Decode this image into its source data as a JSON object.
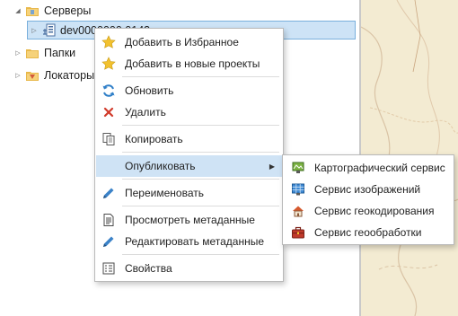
{
  "tree": {
    "servers_label": "Серверы",
    "server_item_label": "dev0000000.0143",
    "folders_label": "Папки",
    "locators_label": "Локаторы"
  },
  "context_menu": {
    "items": [
      {
        "label": "Добавить в Избранное",
        "icon": "star-icon"
      },
      {
        "label": "Добавить в новые проекты",
        "icon": "star-icon"
      },
      {
        "label": "Обновить",
        "icon": "refresh-icon"
      },
      {
        "label": "Удалить",
        "icon": "delete-icon"
      },
      {
        "label": "Копировать",
        "icon": "copy-icon"
      },
      {
        "label": "Опубликовать",
        "icon": "",
        "has_submenu": true,
        "highlighted": true
      },
      {
        "label": "Переименовать",
        "icon": "pencil-icon"
      },
      {
        "label": "Просмотреть метаданные",
        "icon": "metadata-icon"
      },
      {
        "label": "Редактировать метаданные",
        "icon": "pencil-icon"
      },
      {
        "label": "Свойства",
        "icon": "properties-icon"
      }
    ]
  },
  "publish_submenu": {
    "items": [
      {
        "label": "Картографический сервис",
        "icon": "map-service-icon"
      },
      {
        "label": "Сервис изображений",
        "icon": "image-service-icon"
      },
      {
        "label": "Сервис геокодирования",
        "icon": "geocode-service-icon"
      },
      {
        "label": "Сервис геообработки",
        "icon": "geoprocessing-service-icon"
      }
    ]
  },
  "colors": {
    "highlight": "#cfe3f5",
    "selection_border": "#7ab0dc",
    "map_background": "#f3ebd2"
  }
}
